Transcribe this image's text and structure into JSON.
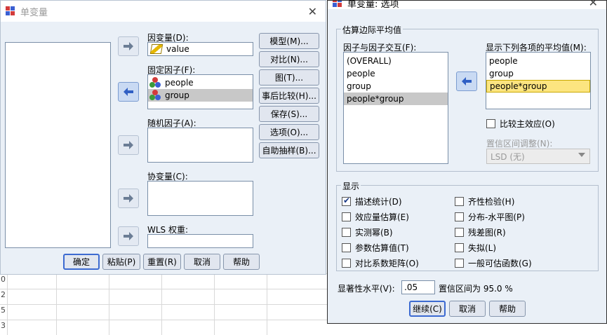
{
  "sheet": {
    "row_numbers": [
      "0",
      "2",
      "5",
      "3"
    ]
  },
  "left_dialog": {
    "title": "单变量",
    "dependent_label": "因变量(D):",
    "dependent_value": "value",
    "fixed_label": "固定因子(F):",
    "fixed_items": [
      "people",
      "group"
    ],
    "random_label": "随机因子(A):",
    "covariate_label": "协变量(C):",
    "wls_label": "WLS 权重:",
    "side_buttons": [
      "模型(M)...",
      "对比(N)...",
      "图(T)...",
      "事后比较(H)...",
      "保存(S)...",
      "选项(O)...",
      "自助抽样(B)..."
    ],
    "bottom_buttons": [
      "确定",
      "粘贴(P)",
      "重置(R)",
      "取消",
      "帮助"
    ]
  },
  "right_dialog": {
    "title": "单变量: 选项",
    "group_emm": "估算边际平均值",
    "factors_label": "因子与因子交互(F):",
    "factors": [
      "(OVERALL)",
      "people",
      "group",
      "people*group"
    ],
    "display_means_label": "显示下列各项的平均值(M):",
    "display_means": [
      "people",
      "group",
      "people*group"
    ],
    "compare_main": "比较主效应(O)",
    "ci_adjust_label": "置信区间调整(N):",
    "ci_adjust_value": "LSD (无)",
    "group_display": "显示",
    "checks_left": [
      {
        "label": "描述统计(D)",
        "checked": true
      },
      {
        "label": "效应量估算(E)",
        "checked": false
      },
      {
        "label": "实测幂(B)",
        "checked": false
      },
      {
        "label": "参数估算值(T)",
        "checked": false
      },
      {
        "label": "对比系数矩阵(O)",
        "checked": false
      }
    ],
    "checks_right": [
      {
        "label": "齐性检验(H)",
        "checked": false
      },
      {
        "label": "分布-水平图(P)",
        "checked": false
      },
      {
        "label": "残差图(R)",
        "checked": false
      },
      {
        "label": "失拟(L)",
        "checked": false
      },
      {
        "label": "一般可估函数(G)",
        "checked": false
      }
    ],
    "sig_label": "显著性水平(V):",
    "sig_value": ".05",
    "ci_text": "置信区间为 95.0 %",
    "buttons": [
      "继续(C)",
      "取消",
      "帮助"
    ]
  },
  "colors": {
    "accent": "#3c6ad1",
    "selection_yellow": "#fce580",
    "selection_gray": "#c8c8c8"
  }
}
